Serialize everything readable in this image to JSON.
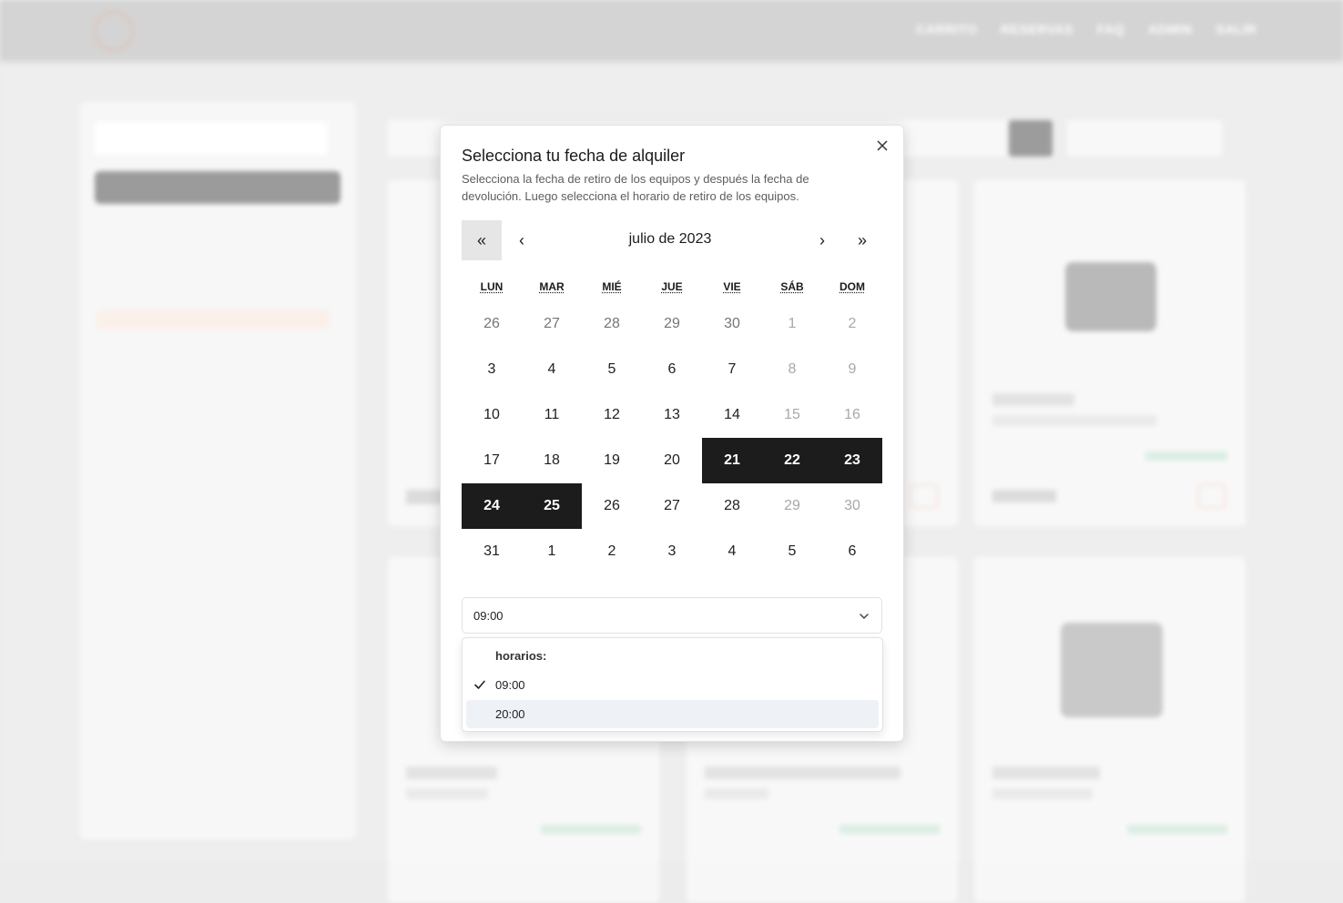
{
  "nav": {
    "items": [
      "CARRITO",
      "RESERVAS",
      "FAQ",
      "ADMIN",
      "SALIR"
    ]
  },
  "modal": {
    "title": "Selecciona tu fecha de alquiler",
    "description": "Selecciona la fecha de retiro de los equipos y después la fecha de devolución. Luego selecciona el horario de retiro de los equipos.",
    "calendar": {
      "nav_prev_year": "«",
      "nav_prev_month": "‹",
      "month_label": "julio de 2023",
      "nav_next_month": "›",
      "nav_next_year": "»",
      "weekdays": [
        "LUN",
        "MAR",
        "MIÉ",
        "JUE",
        "VIE",
        "SÁB",
        "DOM"
      ],
      "weeks": [
        [
          "26",
          "27",
          "28",
          "29",
          "30",
          "1",
          "2"
        ],
        [
          "3",
          "4",
          "5",
          "6",
          "7",
          "8",
          "9"
        ],
        [
          "10",
          "11",
          "12",
          "13",
          "14",
          "15",
          "16"
        ],
        [
          "17",
          "18",
          "19",
          "20",
          "21",
          "22",
          "23"
        ],
        [
          "24",
          "25",
          "26",
          "27",
          "28",
          "29",
          "30"
        ],
        [
          "31",
          "1",
          "2",
          "3",
          "4",
          "5",
          "6"
        ]
      ],
      "selected_range": [
        "21",
        "22",
        "23",
        "24",
        "25"
      ]
    },
    "time_select": {
      "value": "09:00"
    },
    "dropdown": {
      "group_label": "horarios:",
      "options": [
        {
          "label": "09:00",
          "checked": true
        },
        {
          "label": "20:00",
          "checked": false
        }
      ]
    }
  },
  "colors": {
    "selected_day_bg": "#1c1c1c",
    "hover_option_bg": "#eef1f6",
    "muted_weekend": "#a8a8a8"
  },
  "icons": {
    "close": "close-icon",
    "chevron": "chevron-down-icon",
    "check": "check-icon"
  }
}
